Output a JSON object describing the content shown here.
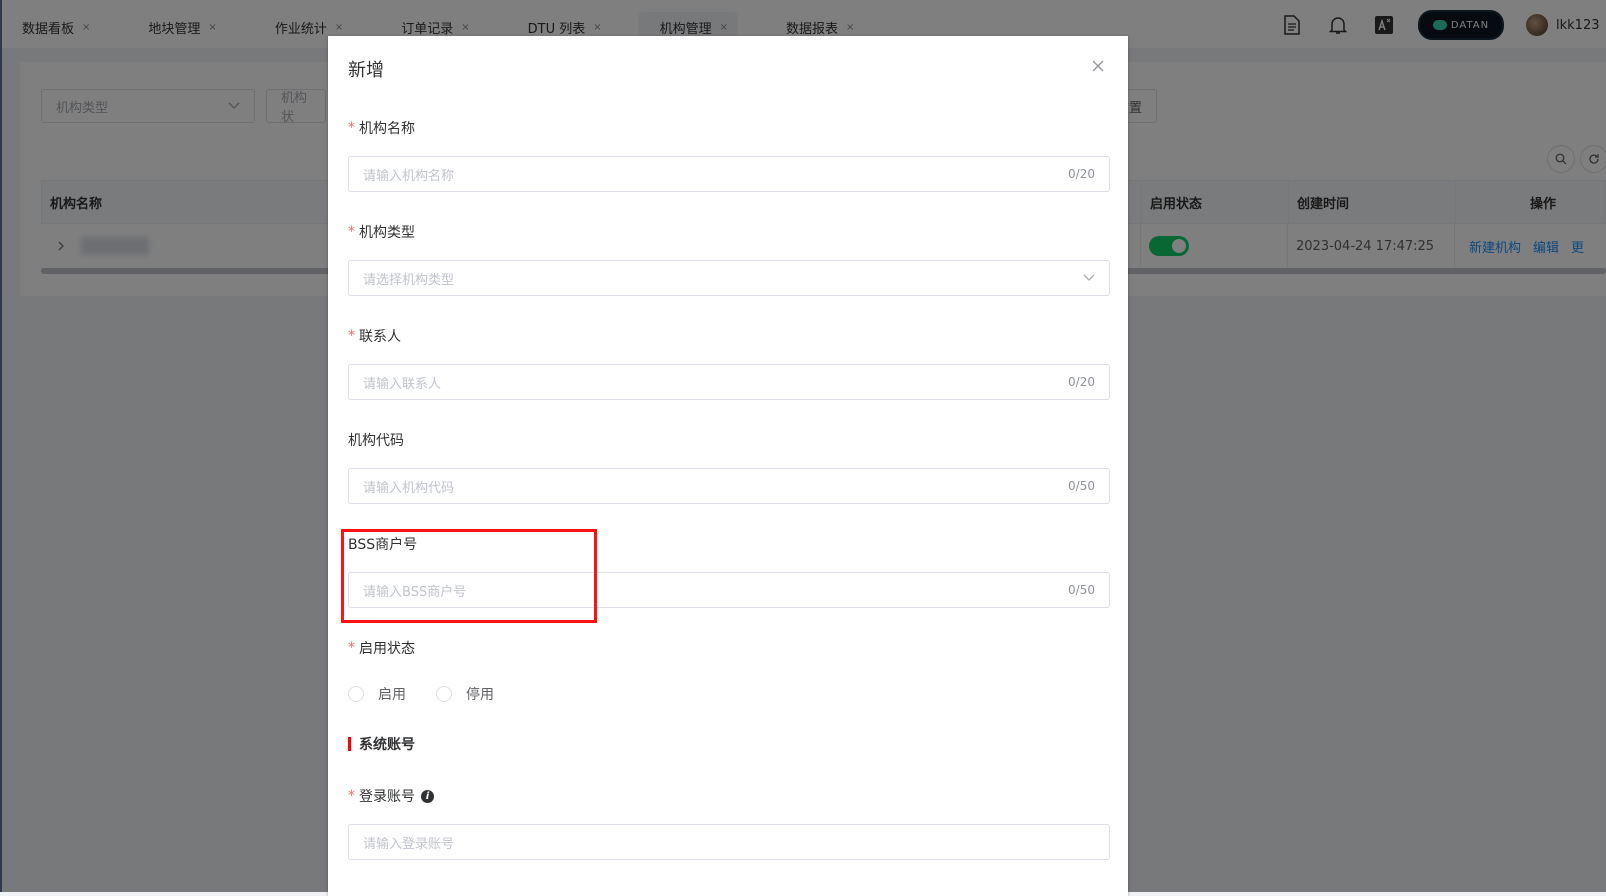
{
  "tabs": [
    {
      "label": "数据看板"
    },
    {
      "label": "地块管理"
    },
    {
      "label": "作业统计"
    },
    {
      "label": "订单记录"
    },
    {
      "label": "DTU 列表"
    },
    {
      "label": "机构管理",
      "active": true
    },
    {
      "label": "数据报表"
    }
  ],
  "tab_close": "×",
  "header": {
    "brand_label": "DATAN",
    "user_name": "lkk123",
    "icons": [
      "document-icon",
      "bell-icon",
      "translate-icon"
    ]
  },
  "filters": {
    "org_type_placeholder": "机构类型",
    "org_status_placeholder": "机构状",
    "reset_label": "重置"
  },
  "table": {
    "headers": {
      "name": "机构名称",
      "status": "启用状态",
      "created": "创建时间",
      "actions": "操作"
    },
    "rows": [
      {
        "created": "2023-04-24 17:47:25",
        "enabled": true,
        "actions": [
          "新建机构",
          "编辑",
          "更"
        ]
      }
    ]
  },
  "dialog": {
    "title": "新增",
    "fields": {
      "org_name": {
        "label": "机构名称",
        "required": true,
        "placeholder": "请输入机构名称",
        "counter": "0/20"
      },
      "org_type": {
        "label": "机构类型",
        "required": true,
        "placeholder": "请选择机构类型"
      },
      "contact": {
        "label": "联系人",
        "required": true,
        "placeholder": "请输入联系人",
        "counter": "0/20"
      },
      "org_code": {
        "label": "机构代码",
        "required": false,
        "placeholder": "请输入机构代码",
        "counter": "0/50"
      },
      "bss": {
        "label": "BSS商户号",
        "required": false,
        "placeholder": "请输入BSS商户号",
        "counter": "0/50"
      },
      "status": {
        "label": "启用状态",
        "required": true,
        "options": [
          "启用",
          "停用"
        ]
      },
      "login": {
        "label": "登录账号",
        "required": true,
        "placeholder": "请输入登录账号"
      }
    },
    "section_title": "系统账号",
    "required_mark": "*",
    "info_mark": "i"
  },
  "colors": {
    "accent": "#1890ff",
    "switch_on": "#13ce66",
    "required": "#f56c6c",
    "highlight": "#ff1111"
  }
}
